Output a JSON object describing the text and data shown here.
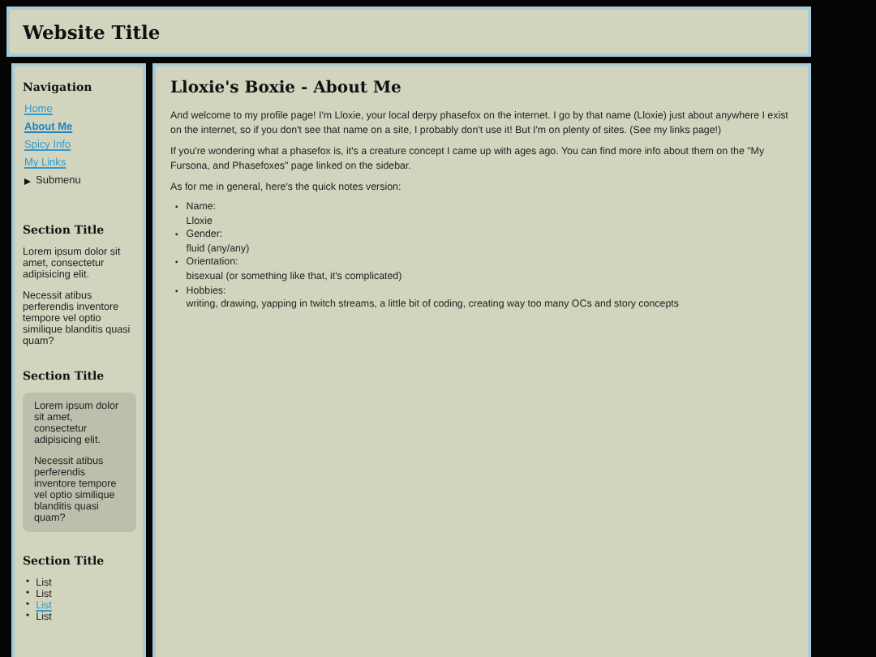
{
  "header": {
    "title": "Website Title"
  },
  "sidebar": {
    "nav_title": "Navigation",
    "nav_items": [
      {
        "label": "Home",
        "selected": false
      },
      {
        "label": "About Me",
        "selected": true
      },
      {
        "label": "Spicy Info",
        "selected": false
      },
      {
        "label": "My Links",
        "selected": false
      }
    ],
    "submenu": {
      "label": "Submenu",
      "expanded": false
    },
    "sections": [
      {
        "title": "Section Title",
        "kind": "text",
        "paragraphs": [
          "Lorem ipsum dolor sit amet, consectetur adipisicing elit.",
          "Necessit atibus perferendis inventore tempore vel optio similique blanditis quasi quam?"
        ]
      },
      {
        "title": "Section Title",
        "kind": "boxed",
        "paragraphs": [
          "Lorem ipsum dolor sit amet, consectetur adipisicing elit.",
          "Necessit atibus perferendis inventore tempore vel optio similique blanditis quasi quam?"
        ]
      },
      {
        "title": "Section Title",
        "kind": "list",
        "items": [
          {
            "marker": "•",
            "label": "List",
            "link": false
          },
          {
            "marker": "•",
            "label": "List",
            "link": false
          },
          {
            "marker": "•",
            "label": "List",
            "link": true
          },
          {
            "marker": "•",
            "label": "List",
            "link": false
          }
        ]
      }
    ]
  },
  "main": {
    "title": "Lloxie's Boxie - About Me",
    "paragraphs": [
      "And welcome to my profile page! I'm Lloxie, your local derpy phasefox on the internet. I go by that name (Lloxie) just about anywhere I exist on the internet, so if you don't see that name on a site, I probably don't use it! But I'm on plenty of sites. (See my links page!)",
      "If you're wondering what a phasefox is, it's a creature concept I came up with ages ago. You can find more info about them on the \"My Fursona, and Phasefoxes\" page linked on the sidebar.",
      "As for me in general, here's the quick notes version:"
    ],
    "facts": [
      {
        "marker": "▪",
        "label": "Name:",
        "value": "Lloxie"
      },
      {
        "marker": "▪",
        "label": "Gender:",
        "value": "fluid (any/any)"
      },
      {
        "marker": "▪",
        "label": "Orientation:",
        "value": "bisexual (or something like that, it's complicated)"
      },
      {
        "marker": "▪",
        "label": "Hobbies:",
        "value": "writing, drawing, yapping in twitch streams, a little bit of coding, creating way too many OCs and story concepts"
      }
    ]
  }
}
